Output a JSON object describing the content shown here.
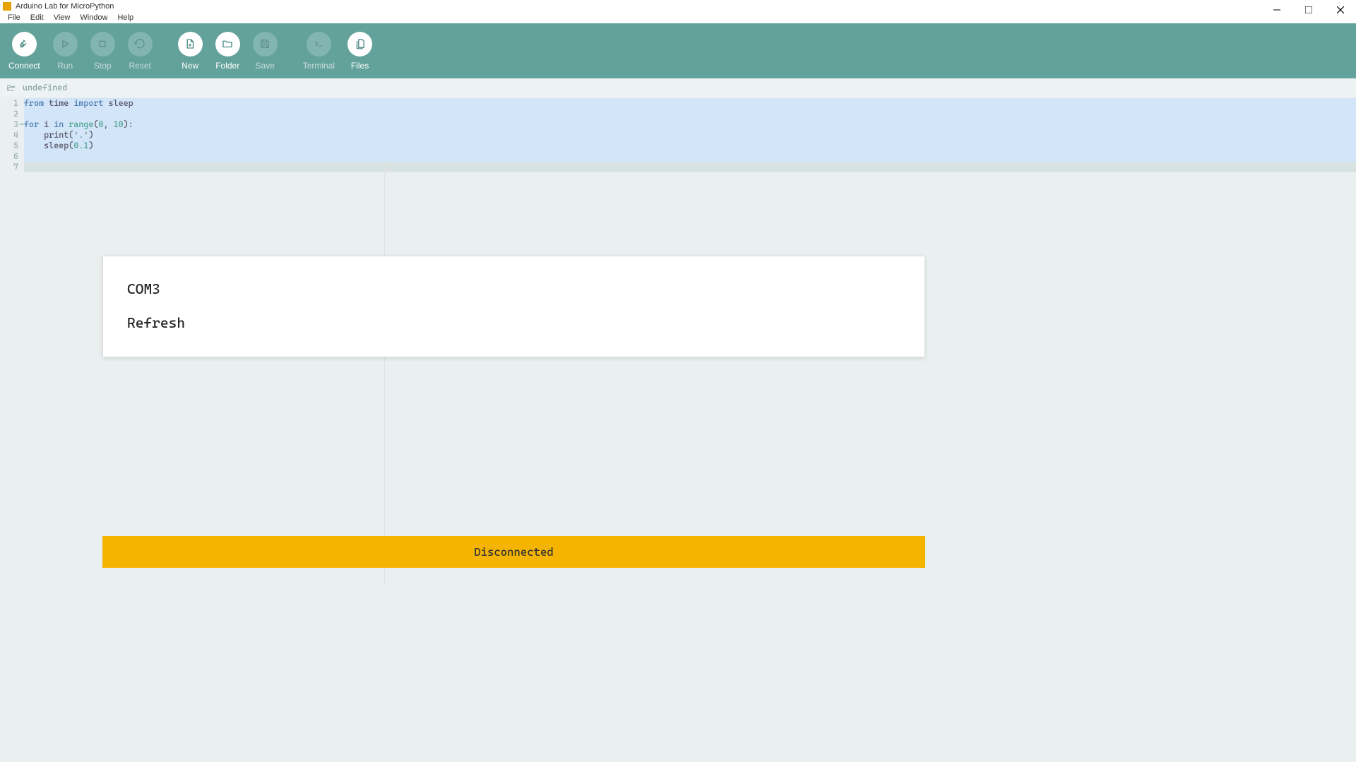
{
  "window": {
    "title": "Arduino Lab for MicroPython"
  },
  "menubar": [
    "File",
    "Edit",
    "View",
    "Window",
    "Help"
  ],
  "toolbar": {
    "groups": [
      [
        {
          "id": "connect",
          "label": "Connect",
          "active": true,
          "icon": "plug"
        },
        {
          "id": "run",
          "label": "Run",
          "active": false,
          "icon": "play"
        },
        {
          "id": "stop",
          "label": "Stop",
          "active": false,
          "icon": "stop"
        },
        {
          "id": "reset",
          "label": "Reset",
          "active": false,
          "icon": "reload"
        }
      ],
      [
        {
          "id": "new",
          "label": "New",
          "active": true,
          "icon": "newfile"
        },
        {
          "id": "folder",
          "label": "Folder",
          "active": true,
          "icon": "folder"
        },
        {
          "id": "save",
          "label": "Save",
          "active": false,
          "icon": "save"
        }
      ],
      [
        {
          "id": "terminal",
          "label": "Terminal",
          "active": false,
          "icon": "terminal"
        },
        {
          "id": "files",
          "label": "Files",
          "active": true,
          "icon": "files"
        }
      ]
    ]
  },
  "pathbar": {
    "filename": "undefined"
  },
  "editor": {
    "lines": [
      "1",
      "2",
      "3",
      "4",
      "5",
      "6",
      "7"
    ],
    "fold_line": 3,
    "tokens": {
      "l1_from": "from",
      "l1_time": "time ",
      "l1_import": "import",
      "l1_sleep": " sleep",
      "l3_for": "for",
      "l3_i": " i ",
      "l3_in": "in",
      "l3_range": " range",
      "l3_paren_o": "(",
      "l3_n0": "0",
      "l3_comma": ", ",
      "l3_n10": "10",
      "l3_paren_c_colon": "):",
      "l4_indent": "    print(",
      "l4_str": "'.'",
      "l4_close": ")",
      "l5_indent": "    sleep(",
      "l5_num": "0.1",
      "l5_close": ")"
    }
  },
  "dialog": {
    "items": [
      "COM3",
      "Refresh"
    ]
  },
  "status": {
    "text": "Disconnected"
  }
}
